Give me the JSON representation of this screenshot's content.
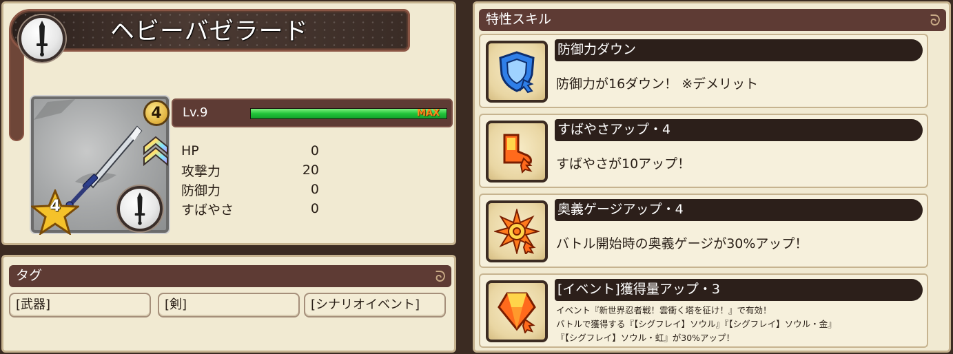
{
  "item": {
    "name": "ヘビーバゼラード",
    "rarity": "4",
    "stars": "4",
    "level_label": "Lv.9",
    "level_max_label": "MAX",
    "exp_progress": 1.0
  },
  "stats": [
    {
      "label": "HP",
      "value": "0"
    },
    {
      "label": "攻撃力",
      "value": "20"
    },
    {
      "label": "防御力",
      "value": "0"
    },
    {
      "label": "すばやさ",
      "value": "0"
    }
  ],
  "tags": {
    "header": "タグ",
    "items": [
      "[武器]",
      "[剣]",
      "[シナリオイベント]"
    ]
  },
  "skills": {
    "header": "特性スキル",
    "items": [
      {
        "title": "防御力ダウン",
        "desc": "防御力が16ダウン！ ※デメリット",
        "icon": "shield-down-icon"
      },
      {
        "title": "すばやさアップ・4",
        "desc": "すばやさが10アップ！",
        "icon": "boot-up-icon"
      },
      {
        "title": "奥義ゲージアップ・4",
        "desc": "バトル開始時の奥義ゲージが30%アップ！",
        "icon": "burst-gauge-icon"
      },
      {
        "title": "[イベント]獲得量アップ・3",
        "desc_lines": [
          "イベント『新世界忍者戦！雲衝く塔を征け！』で有効！",
          "バトルで獲得する『【シグフレイ】ソウル』『【シグフレイ】ソウル・金』",
          "『【シグフレイ】ソウル・虹』が30%アップ！"
        ],
        "icon": "gem-up-icon"
      }
    ]
  },
  "colors": {
    "panel_bg": "#f1ead2",
    "header_bg": "#5e3b34",
    "skill_title_bg": "#2c1f1a",
    "exp_fill": "#22c43a",
    "max_label": "#ff8a1c"
  }
}
